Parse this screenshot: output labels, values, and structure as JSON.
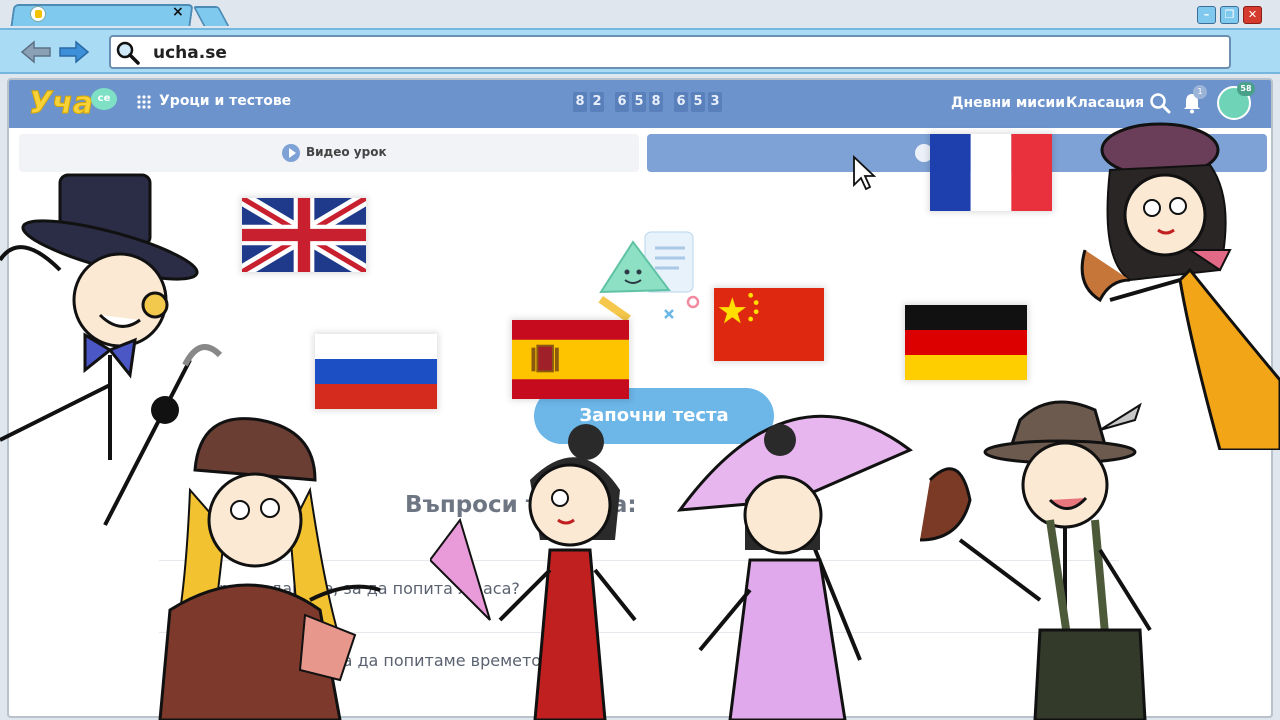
{
  "browser": {
    "tab_close_glyph": "×",
    "url": "ucha.se",
    "window_buttons": {
      "minimize": "–",
      "maximize": "❐",
      "close": "✕"
    }
  },
  "site": {
    "logo_text": "Уча",
    "logo_badge": "се",
    "lessons_link": "Уроци и тестове",
    "counter_digits": [
      "8",
      "2",
      "6",
      "5",
      "8",
      "6",
      "5",
      "3"
    ],
    "missions_link": "Дневни мисии",
    "ranking_link": "Класация",
    "bell_badge": "1",
    "avatar_badge": "58",
    "colors": {
      "header": "#6c93cc",
      "accent": "#6cb6e8",
      "logo_yellow": "#f7d339"
    }
  },
  "tabs": {
    "video_label": "Видео урок",
    "test_icon": "pencil-icon"
  },
  "main": {
    "start_button": "Започни теста",
    "questions_title": "Въпроси           то ще           а:",
    "questions": [
      {
        "text": "      рос задаваме, за да попита      лк      аса?"
      },
      {
        "text": "     ак      задаваме, за да попитаме     времето?"
      }
    ]
  },
  "flags": [
    "flag-uk",
    "flag-ru",
    "flag-es",
    "flag-cn",
    "flag-de",
    "flag-fr"
  ]
}
